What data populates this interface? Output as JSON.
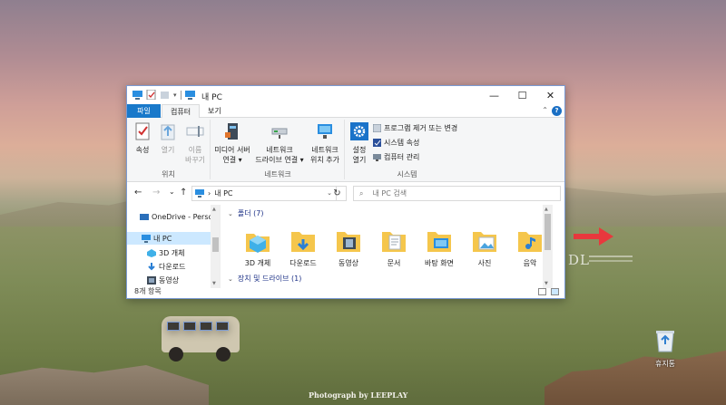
{
  "window": {
    "title": "내 PC",
    "caption": {
      "minimize": "—",
      "maximize": "☐",
      "close": "✕"
    }
  },
  "ribbon_tabs": {
    "file": "파일",
    "computer": "컴퓨터",
    "view": "보기",
    "collapse": "⌃",
    "help": "?"
  },
  "ribbon": {
    "location_group": {
      "label": "위치",
      "properties": "속성",
      "open": "열기",
      "rename_1": "이름",
      "rename_2": "바꾸기"
    },
    "network_group": {
      "label": "네트워크",
      "media_server_1": "미디어 서버",
      "media_server_2": "연결",
      "map_drive_1": "네트워크",
      "map_drive_2": "드라이브 연결",
      "add_location_1": "네트워크",
      "add_location_2": "위치 추가"
    },
    "system_group": {
      "label": "시스템",
      "settings_1": "설정",
      "settings_2": "열기",
      "uninstall": "프로그램 제거 또는 변경",
      "system_props": "시스템 속성",
      "manage": "컴퓨터 관리"
    }
  },
  "navbar": {
    "back": "←",
    "forward": "→",
    "recent": "⌄",
    "up": "↑",
    "address": "내 PC",
    "address_sep": "›",
    "address_dropdown": "⌄",
    "refresh": "↻",
    "search_placeholder": "내 PC 검색",
    "search_icon": "⌕"
  },
  "nav_pane": {
    "items": [
      {
        "label": "OneDrive - Person",
        "icon": "onedrive-icon"
      },
      {
        "label": "내 PC",
        "icon": "pc-icon",
        "selected": true
      },
      {
        "label": "3D 개체",
        "icon": "3d-objects-icon"
      },
      {
        "label": "다운로드",
        "icon": "download-icon"
      },
      {
        "label": "동영상",
        "icon": "video-icon"
      }
    ]
  },
  "main_pane": {
    "folders_header": "폴더 (7)",
    "drives_header": "장치 및 드라이브 (1)",
    "folders": [
      {
        "label": "3D 개체",
        "icon": "3d-objects-folder-icon"
      },
      {
        "label": "다운로드",
        "icon": "downloads-folder-icon"
      },
      {
        "label": "동영상",
        "icon": "videos-folder-icon"
      },
      {
        "label": "문서",
        "icon": "documents-folder-icon"
      },
      {
        "label": "바탕 화면",
        "icon": "desktop-folder-icon"
      },
      {
        "label": "사진",
        "icon": "pictures-folder-icon"
      },
      {
        "label": "음악",
        "icon": "music-folder-icon"
      }
    ]
  },
  "status_bar": {
    "item_count": "8개 항목"
  },
  "desktop": {
    "recycle_bin": "휴지통",
    "photo_credit": "Photograph by LEEPLAY",
    "watermark": "DL"
  },
  "colors": {
    "accent": "#1979ca",
    "selection": "#cce8ff",
    "folder_yellow": "#f5c64c",
    "arrow_red": "#e8383d"
  }
}
